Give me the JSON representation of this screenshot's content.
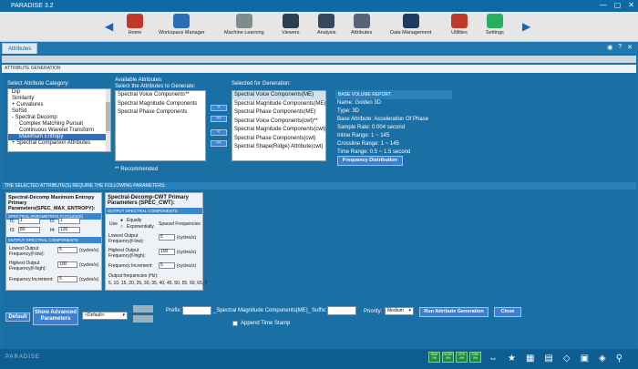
{
  "window": {
    "title": "PARADISE 3.2",
    "minimize": "—",
    "maximize": "▢",
    "close": "✕"
  },
  "ribbon": {
    "items": [
      {
        "label": "Home",
        "icon": "home-icon",
        "color": "#c0392b"
      },
      {
        "label": "Workspace Manager",
        "icon": "workspace-icon",
        "color": "#2a6fb5"
      },
      {
        "label": "Machine Learning",
        "icon": "machine-learning-icon",
        "color": "#7f8c8d"
      },
      {
        "label": "Viewers",
        "icon": "viewers-icon",
        "color": "#2c3e50"
      },
      {
        "label": "Analysis",
        "icon": "analysis-icon",
        "color": "#34495e"
      },
      {
        "label": "Attributes",
        "icon": "attributes-icon",
        "color": "#566573"
      },
      {
        "label": "Data Management",
        "icon": "data-management-icon",
        "color": "#1f3a60"
      },
      {
        "label": "Utilities",
        "icon": "utilities-icon",
        "color": "#c0392b"
      },
      {
        "label": "Settings",
        "icon": "settings-icon",
        "color": "#27ae60"
      }
    ]
  },
  "tabstrip": {
    "active_tab": "Attributes"
  },
  "section": {
    "title": "ATTRIBUTE GENERATION"
  },
  "category": {
    "label": "Select Attribute Category:",
    "items": [
      "Dip",
      "Similarity",
      "+ Curvatures",
      "SofSd",
      "- Spectral Decomp",
      "Complex Matching Pursuit",
      "Continuous Wavelet Transform",
      "Maximum Entropy",
      "+ Spectral Companion Attributes"
    ],
    "selected_index": 7
  },
  "available": {
    "label1": "Available Attributes:",
    "label2": "Select the Attributes to Generate:",
    "items": [
      "Spectral Voice Components**",
      "Spectral Magnitude Components",
      "Spectral Phase Components"
    ],
    "note": "** Recommended"
  },
  "transfer": {
    "add": ">",
    "add_all": ">>",
    "remove": "<",
    "remove_all": "<<"
  },
  "selected": {
    "label": "Selected for Generation:",
    "items": [
      "Spectral Voice Components(ME)",
      "Spectral Magnitude Components(ME)",
      "Spectral Phase Components(ME)",
      "Spectral Voice Components(cwt)**",
      "Spectral Magnitude Components(cwt)",
      "Spectral Phase Components(cwt)",
      "Spectral Shape(Ridge) Attribute(cwt)"
    ]
  },
  "report": {
    "header": "BASE VOLUME REPORT",
    "lines": [
      "Name: Golden 3D",
      "Type: 3D",
      "Base Attribute: Acceleration Of Phase",
      "Sample Rate: 0.004 second",
      "Inline Range: 1 ~ 145",
      "Crossline Range: 1 ~ 145",
      "Time Range: 0.5 ~ 1.5 second"
    ],
    "button": "Frequency Distribution"
  },
  "requirement": {
    "text": "THE SELECTED ATTRIBUTE(S) REQUIRE THE FOLLOWING PARAMETERS:"
  },
  "me_params": {
    "title": "Spectral-Decomp Maximum Entropy Primary Parameters(SPEC_MAX_ENTROPY):",
    "band1": "SPECTRAL PARAMETERS (CYCLES/S)",
    "f1_label": "f1:",
    "f1": "1",
    "f2_label": "f2:",
    "f2": "1",
    "f3_label": "f3:",
    "f3": "80",
    "f4_label": "f4:",
    "f4": "120",
    "band2": "OUTPUT SPECTRAL COMPONENTS",
    "lowest_label": "Lowest Output Frequency(f-low):",
    "lowest": "5",
    "lowest_unit": "(cycles/s)",
    "highest_label": "Highest Output Frequency(f-high):",
    "highest": "100",
    "highest_unit": "(cycles/s)",
    "inc_label": "Frequency Increment:",
    "inc": "5",
    "inc_unit": "(cycles/s)"
  },
  "cwt_params": {
    "title": "Spectral-Decomp-CWT Primary Parameters (SPEC_CWT):",
    "band": "OUTPUT SPECTRAL COMPONENTS",
    "use_label": "Use",
    "opt_equally": "Equally",
    "opt_expo": "Exponentially",
    "spaced": "Spaced Frequencies",
    "lowest_label": "Lowest Output Frequency(f-low):",
    "lowest": "5",
    "lowest_unit": "(cycles/s)",
    "highest_label": "Highest Output Frequency(f-high):",
    "highest": "100",
    "highest_unit": "(cycles/s)",
    "inc_label": "Frequency Increment:",
    "inc": "5",
    "inc_unit": "(cycles/s)",
    "out_label": "Output frequencies (Hz):",
    "out_values": "5, 10, 15, 20, 25, 30, 35, 40, 45, 50, 55, 60, 65, 7"
  },
  "bottom": {
    "default": "Default",
    "show_advanced": "Show Advanced Parameters",
    "default_select": "<Default>",
    "prefix_label": "Prefix:",
    "prefix": "",
    "middle_label": "_Spectral Magnitude Components(ME)_",
    "suffix_label": "Suffix:",
    "suffix": "",
    "priority_label": "Priority:",
    "priority": "Medium",
    "run": "Run Attribute Generation",
    "close": "Close",
    "append_label": "Append Time Stamp"
  },
  "taskbar": {
    "logo": "PARADISE",
    "status": [
      "RAM 1%",
      "NODE 4%",
      "CPU 4%",
      "DISK 0%"
    ]
  }
}
